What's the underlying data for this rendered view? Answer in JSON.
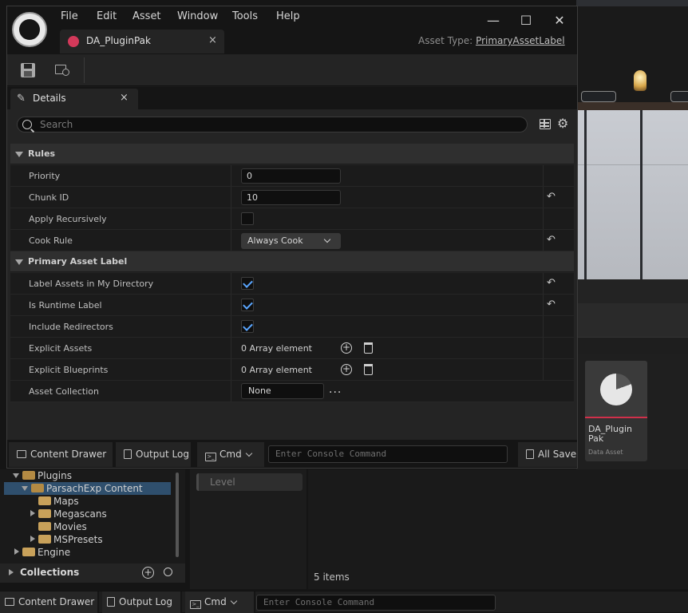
{
  "window": {
    "menu": [
      "File",
      "Edit",
      "Asset",
      "Window",
      "Tools",
      "Help"
    ],
    "tab_label": "DA_PluginPak",
    "tab_close": "×",
    "asset_type_label": "Asset Type:",
    "asset_type_value": "PrimaryAssetLabel",
    "controls": {
      "minimize": "—",
      "maximize": "☐",
      "close": "✕"
    }
  },
  "details": {
    "tab_label": "Details",
    "tab_close": "×",
    "search_placeholder": "Search",
    "categories": [
      {
        "label": "Rules"
      },
      {
        "label": "Primary Asset Label"
      }
    ],
    "rules": {
      "priority_label": "Priority",
      "priority_value": "0",
      "chunk_label": "Chunk ID",
      "chunk_value": "10",
      "recursive_label": "Apply Recursively",
      "cook_label": "Cook Rule",
      "cook_value": "Always Cook"
    },
    "label": {
      "label_dir": "Label Assets in My Directory",
      "runtime": "Is Runtime Label",
      "redirectors": "Include Redirectors",
      "explicit_assets": "Explicit Assets",
      "explicit_assets_value": "0 Array element",
      "explicit_blueprints": "Explicit Blueprints",
      "explicit_blueprints_value": "0 Array element",
      "collection": "Asset Collection",
      "collection_value": "None",
      "collection_dots": "..."
    },
    "checkbox_states": {
      "apply_recursively": false,
      "label_assets_in_my_directory": true,
      "is_runtime_label": true,
      "include_redirectors": true
    }
  },
  "window_bottom": {
    "content_drawer": "Content Drawer",
    "output_log": "Output Log",
    "cmd": "Cmd",
    "console_placeholder": "Enter Console Command",
    "all_saved": "All Save"
  },
  "content_browser": {
    "tree": [
      "Plugins",
      "ParsachExp Content",
      "Maps",
      "Megascans",
      "Movies",
      "MSPresets",
      "Engine"
    ],
    "collections": "Collections",
    "level_filter": "Level",
    "items_count": "5 items",
    "asset_name": "DA_Plugin Pak",
    "asset_type": "Data Asset"
  },
  "main_bottom": {
    "content_drawer": "Content Drawer",
    "output_log": "Output Log",
    "cmd": "Cmd",
    "console_placeholder": "Enter Console Command"
  },
  "colors": {
    "accent": "#d3395a",
    "check": "#5aa6ff",
    "selection": "#2f4f6d"
  }
}
